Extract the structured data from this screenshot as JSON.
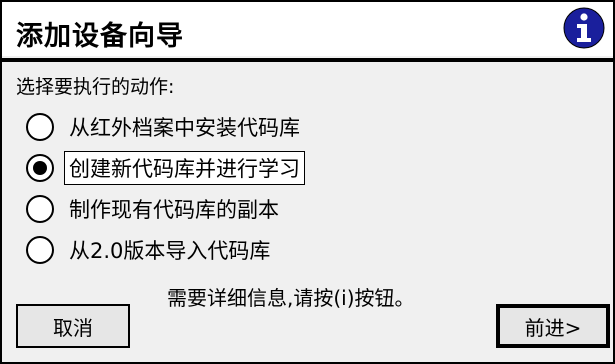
{
  "window": {
    "title": "添加设备向导",
    "info_icon": "info-icon",
    "accent_color": "#1a1f9c"
  },
  "prompt": "选择要执行的动作:",
  "options": [
    {
      "label": "从红外档案中安装代码库",
      "selected": false
    },
    {
      "label": "创建新代码库并进行学习",
      "selected": true
    },
    {
      "label": "制作现有代码库的副本",
      "selected": false
    },
    {
      "label": "从2.0版本导入代码库",
      "selected": false
    }
  ],
  "hint": "需要详细信息,请按(i)按钮。",
  "buttons": {
    "cancel": "取消",
    "next": "前进>"
  }
}
